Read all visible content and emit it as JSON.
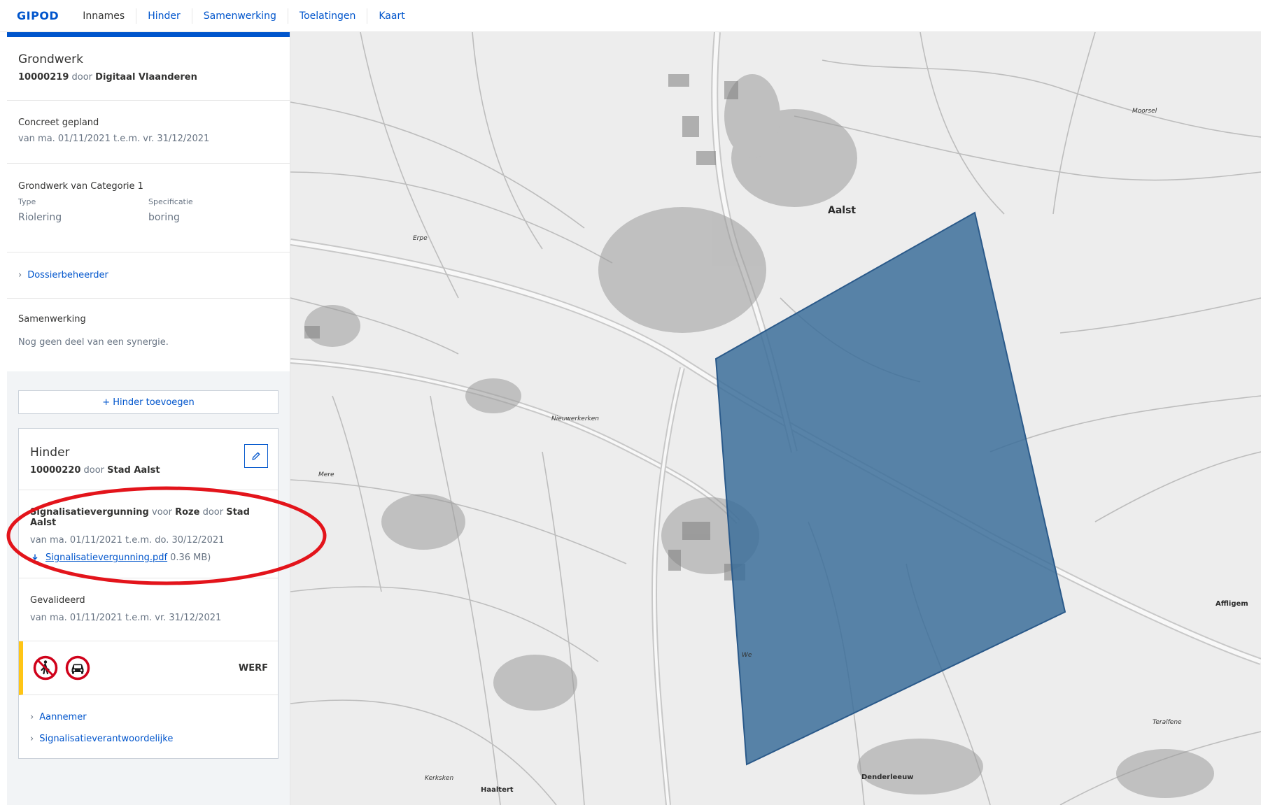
{
  "nav": {
    "brand": "GIPOD",
    "items": [
      {
        "label": "Innames",
        "style": "plain"
      },
      {
        "label": "Hinder",
        "style": "link"
      },
      {
        "label": "Samenwerking",
        "style": "link"
      },
      {
        "label": "Toelatingen",
        "style": "link"
      },
      {
        "label": "Kaart",
        "style": "link"
      }
    ]
  },
  "grondwerk": {
    "title": "Grondwerk",
    "id": "10000219",
    "door": "door",
    "owner": "Digitaal Vlaanderen"
  },
  "planning": {
    "status": "Concreet gepland",
    "period": "van ma. 01/11/2021 t.e.m. vr. 31/12/2021"
  },
  "categorie": {
    "title": "Grondwerk van Categorie 1",
    "type_label": "Type",
    "type_value": "Riolering",
    "spec_label": "Specificatie",
    "spec_value": "boring"
  },
  "dossier": {
    "link_label": "Dossierbeheerder"
  },
  "samenwerking": {
    "title": "Samenwerking",
    "text": "Nog geen deel van een synergie."
  },
  "add_hinder": {
    "label": "+ Hinder toevoegen"
  },
  "hinder": {
    "title": "Hinder",
    "id": "10000220",
    "door": "door",
    "owner": "Stad Aalst",
    "permit": {
      "type": "Signalisatievergunning",
      "voor": "voor",
      "subject": "Roze",
      "door": "door",
      "owner": "Stad Aalst",
      "period": "van ma. 01/11/2021 t.e.m. do. 30/12/2021",
      "file_name": "Signalisatievergunning.pdf",
      "file_size": "0.36 MB)"
    },
    "validation": {
      "status": "Gevalideerd",
      "period": "van ma. 01/11/2021 t.e.m. vr. 31/12/2021"
    },
    "signs": {
      "label": "WERF",
      "icons": [
        "no-pedestrians-icon",
        "no-cars-icon"
      ]
    },
    "links": [
      "Aannemer",
      "Signalisatieverantwoordelijke"
    ]
  },
  "map": {
    "places": [
      {
        "name": "Aalst",
        "kind": "big"
      },
      {
        "name": "Moorsel",
        "kind": "small"
      },
      {
        "name": "Erpe",
        "kind": "small"
      },
      {
        "name": "Nieuwerkerken",
        "kind": "small"
      },
      {
        "name": "Mere",
        "kind": "small"
      },
      {
        "name": "Affligem",
        "kind": "med"
      },
      {
        "name": "Denderleeuw",
        "kind": "med"
      },
      {
        "name": "Haaltert",
        "kind": "med"
      },
      {
        "name": "Kerksken",
        "kind": "small"
      },
      {
        "name": "Teralfene",
        "kind": "small"
      },
      {
        "name": "We",
        "kind": "small"
      }
    ],
    "polygon_color": "#3c6f9a",
    "annotation_color": "#e3141b"
  },
  "colors": {
    "accent": "#0055cc",
    "sign_red": "#d0021b",
    "warning_yellow": "#ffc515"
  }
}
